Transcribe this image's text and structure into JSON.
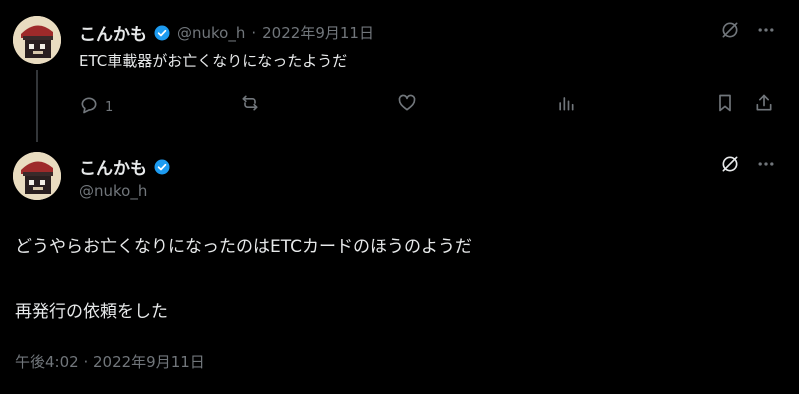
{
  "tweet1": {
    "display_name": "こんかも",
    "handle": "@nuko_h",
    "separator": "·",
    "date": "2022年9月11日",
    "text": "ETC車載器がお亡くなりになったようだ",
    "reply_count": "1"
  },
  "tweet2": {
    "display_name": "こんかも",
    "handle": "@nuko_h",
    "text_line1": "どうやらお亡くなりになったのはETCカードのほうのようだ",
    "text_line2": "再発行の依頼をした",
    "timestamp": "午後4:02 · 2022年9月11日"
  },
  "colors": {
    "background": "#000000",
    "text": "#e7e9ea",
    "muted": "#71767b",
    "verified": "#1d9bf0",
    "thread_line": "#333639"
  },
  "icons": [
    "verified-badge-icon",
    "grok-icon",
    "more-icon",
    "reply-icon",
    "retweet-icon",
    "like-icon",
    "views-icon",
    "bookmark-icon",
    "share-icon"
  ]
}
